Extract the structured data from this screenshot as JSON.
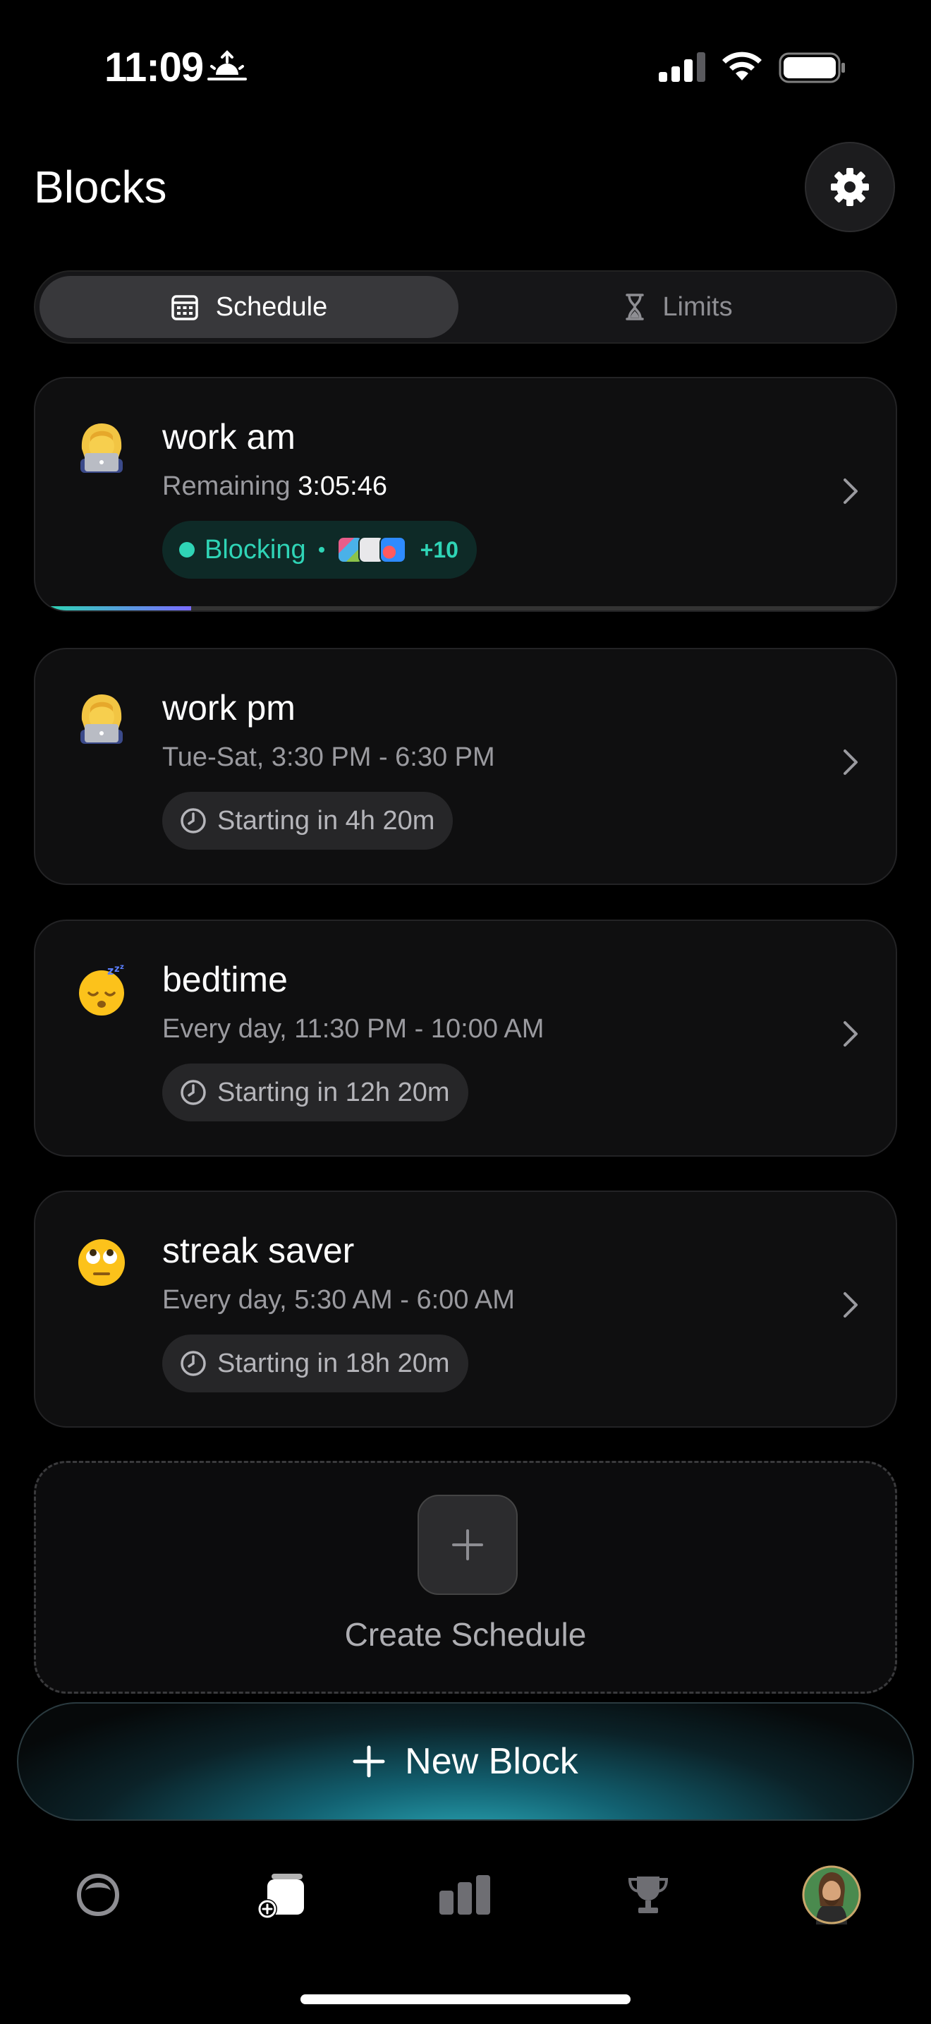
{
  "status_bar": {
    "time": "11:09"
  },
  "header": {
    "title": "Blocks"
  },
  "tabs": [
    {
      "label": "Schedule",
      "icon": "calendar-icon",
      "active": true
    },
    {
      "label": "Limits",
      "icon": "hourglass-icon",
      "active": false
    }
  ],
  "cards": [
    {
      "name": "work am",
      "emoji": "woman-technologist",
      "remaining_label": "Remaining",
      "remaining_time": "3:05:46",
      "status_label": "Blocking",
      "extra_apps": "+10",
      "progress": 0.17,
      "accent_colors": [
        "#2fd4b6",
        "#7a6bff"
      ]
    },
    {
      "name": "work pm",
      "emoji": "woman-technologist",
      "schedule": "Tue-Sat, 3:30 PM - 6:30 PM",
      "starting": "Starting in 4h 20m"
    },
    {
      "name": "bedtime",
      "emoji": "sleeping-face",
      "schedule": "Every day, 11:30 PM - 10:00 AM",
      "starting": "Starting in 12h 20m"
    },
    {
      "name": "streak saver",
      "emoji": "face-rolling-eyes",
      "schedule": "Every day, 5:30 AM - 6:00 AM",
      "starting": "Starting in 18h 20m"
    }
  ],
  "create": {
    "label": "Create Schedule"
  },
  "new_block": {
    "label": "New Block"
  },
  "tab_bar": [
    {
      "icon": "opal-gem-icon",
      "active": false
    },
    {
      "icon": "blocks-icon",
      "active": true
    },
    {
      "icon": "stats-icon",
      "active": false
    },
    {
      "icon": "trophy-icon",
      "active": false
    },
    {
      "icon": "profile-avatar",
      "active": false
    }
  ]
}
